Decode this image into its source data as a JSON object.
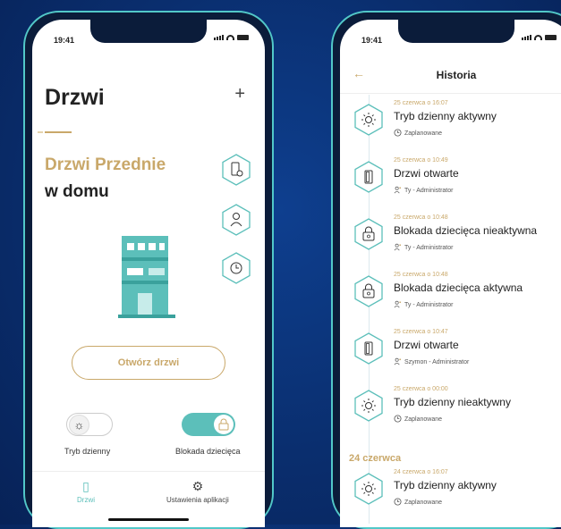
{
  "left_phone": {
    "status_time": "19:41",
    "page_title": "Drzwi",
    "add_icon": "plus-icon",
    "door_name": "Drzwi Przednie",
    "door_location": "w domu",
    "side_actions": [
      "door-settings-icon",
      "user-icon",
      "history-icon"
    ],
    "open_button": "Otwórz drzwi",
    "toggle_day_mode": {
      "label": "Tryb dzienny",
      "on": false
    },
    "toggle_child_lock": {
      "label": "Blokada dziecięca",
      "on": true
    },
    "tabs": [
      {
        "label": "Drzwi",
        "icon": "door-icon",
        "active": true
      },
      {
        "label": "Ustawienia aplikacji",
        "icon": "gear-icon",
        "active": false
      }
    ]
  },
  "right_phone": {
    "status_time": "19:41",
    "title": "Historia",
    "entries": [
      {
        "date": "25 czerwca o 16:07",
        "title": "Tryb dzienny aktywny",
        "sub": "Zaplanowane",
        "icon": "sun-icon",
        "sub_icon": "clock-icon"
      },
      {
        "date": "25 czerwca o 10:49",
        "title": "Drzwi otwarte",
        "sub": "Ty - Administrator",
        "icon": "door-icon",
        "sub_icon": "admin-icon"
      },
      {
        "date": "25 czerwca o 10:48",
        "title": "Blokada dziecięca nieaktywna",
        "sub": "Ty - Administrator",
        "icon": "child-lock-icon",
        "sub_icon": "admin-icon"
      },
      {
        "date": "25 czerwca o 10:48",
        "title": "Blokada dziecięca aktywna",
        "sub": "Ty - Administrator",
        "icon": "child-lock-icon",
        "sub_icon": "admin-icon"
      },
      {
        "date": "25 czerwca o 10:47",
        "title": "Drzwi otwarte",
        "sub": "Szymon - Administrator",
        "icon": "door-icon",
        "sub_icon": "admin-icon"
      },
      {
        "date": "25 czerwca o 00:00",
        "title": "Tryb dzienny nieaktywny",
        "sub": "Zaplanowane",
        "icon": "sun-icon",
        "sub_icon": "clock-icon"
      }
    ],
    "day_header": "24 czerwca",
    "entries_2": [
      {
        "date": "24 czerwca o 16:07",
        "title": "Tryb dzienny aktywny",
        "sub": "Zaplanowane",
        "icon": "sun-icon",
        "sub_icon": "clock-icon"
      }
    ]
  },
  "colors": {
    "accent": "#c9a86a",
    "teal": "#5cbfba",
    "background": "#0a2e6e"
  }
}
